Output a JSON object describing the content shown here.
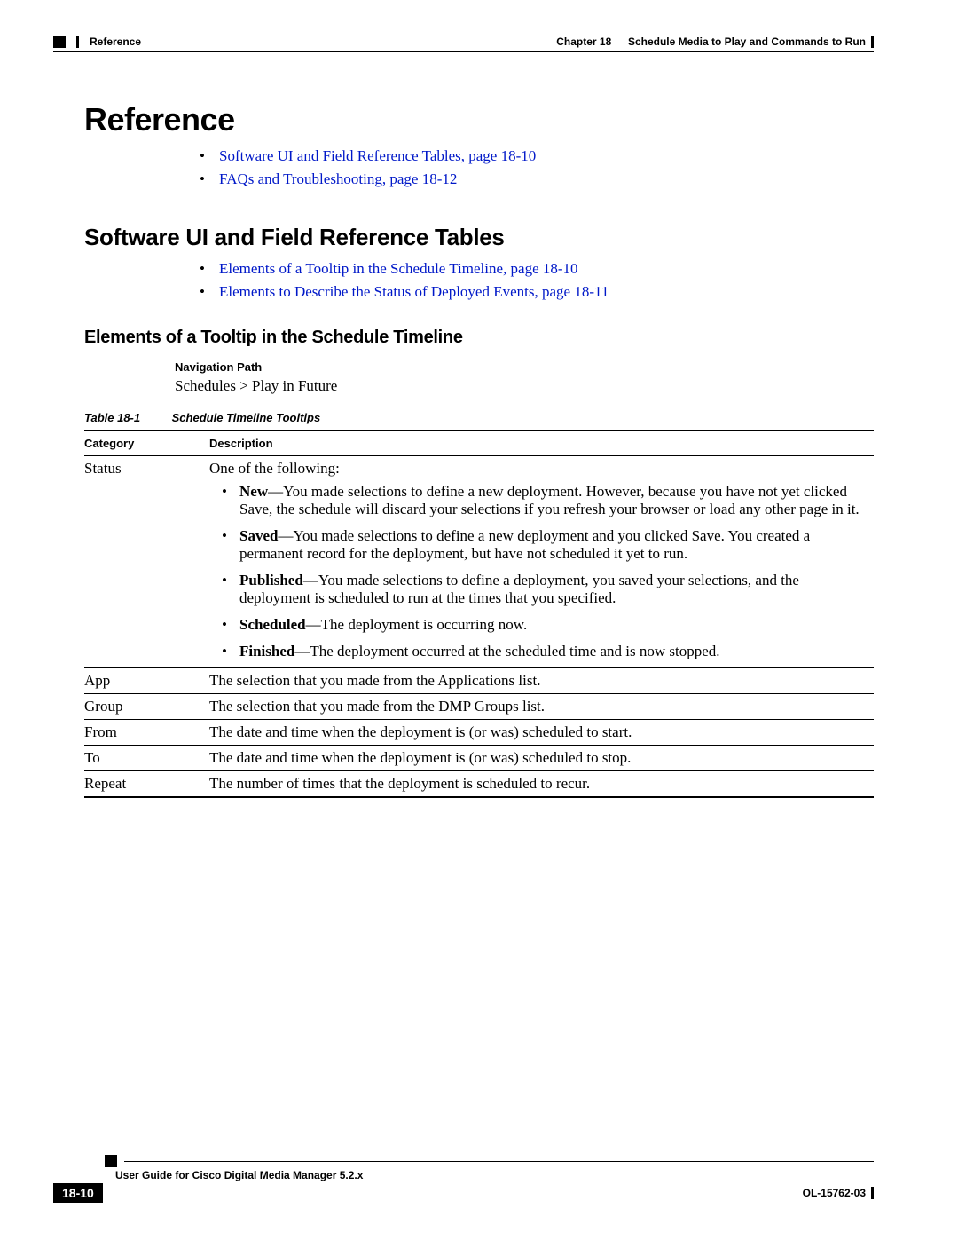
{
  "header": {
    "left_section": "Reference",
    "right_chapter_label": "Chapter 18",
    "right_chapter_title": "Schedule Media to Play and Commands to Run"
  },
  "headings": {
    "h1": "Reference",
    "h2": "Software UI and Field Reference Tables",
    "h3": "Elements of a Tooltip in the Schedule Timeline"
  },
  "links": {
    "top": [
      "Software UI and Field Reference Tables, page 18-10",
      "FAQs and Troubleshooting, page 18-12"
    ],
    "sub": [
      "Elements of a Tooltip in the Schedule Timeline, page 18-10",
      "Elements to Describe the Status of Deployed Events, page 18-11"
    ]
  },
  "nav_path": {
    "label": "Navigation Path",
    "value": "Schedules > Play in Future"
  },
  "table": {
    "caption_num": "Table 18-1",
    "caption_title": "Schedule Timeline Tooltips",
    "headers": {
      "cat": "Category",
      "desc": "Description"
    },
    "status": {
      "cat": "Status",
      "intro": "One of the following:",
      "items": {
        "new": {
          "term": "New",
          "text": "—You made selections to define a new deployment. However, because you have not yet clicked Save, the schedule will discard your selections if you refresh your browser or load any other page in it."
        },
        "saved": {
          "term": "Saved",
          "text": "—You made selections to define a new deployment and you clicked Save. You created a permanent record for the deployment, but have not scheduled it yet to run."
        },
        "published": {
          "term": "Published",
          "text": "—You made selections to define a deployment, you saved your selections, and the deployment is scheduled to run at the times that you specified."
        },
        "scheduled": {
          "term": "Scheduled",
          "text": "—The deployment is occurring now."
        },
        "finished": {
          "term": "Finished",
          "text": "—The deployment occurred at the scheduled time and is now stopped."
        }
      }
    },
    "rows": {
      "app": {
        "cat": "App",
        "desc": "The selection that you made from the Applications list."
      },
      "group": {
        "cat": "Group",
        "desc": "The selection that you made from the DMP Groups list."
      },
      "from": {
        "cat": "From",
        "desc": "The date and time when the deployment is (or was) scheduled to start."
      },
      "to": {
        "cat": "To",
        "desc": "The date and time when the deployment is (or was) scheduled to stop."
      },
      "repeat": {
        "cat": "Repeat",
        "desc": "The number of times that the deployment is scheduled to recur."
      }
    }
  },
  "footer": {
    "book_title": "User Guide for Cisco Digital Media Manager 5.2.x",
    "page_number": "18-10",
    "doc_id": "OL-15762-03"
  }
}
